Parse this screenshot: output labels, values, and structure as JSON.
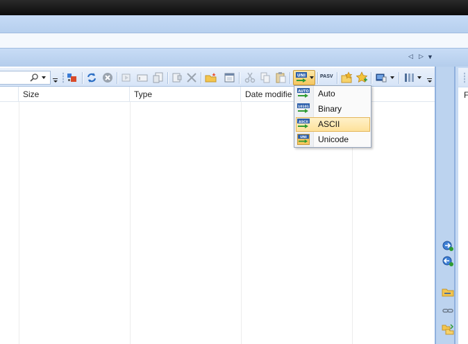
{
  "window": {
    "title": ""
  },
  "columns": [
    {
      "label": ""
    },
    {
      "label": "Size"
    },
    {
      "label": "Type"
    },
    {
      "label": "Date modifie"
    },
    {
      "label": ""
    }
  ],
  "right_pane": {
    "column_label": "F"
  },
  "toolbar": {
    "pasv_label": "PASV",
    "buttons": [
      "search-icon",
      "queue-icon",
      "refresh-icon",
      "stop-icon",
      "connect-icon",
      "rename-icon",
      "properties-icon",
      "view-icon",
      "delete-icon",
      "new-folder-icon",
      "copy-window-icon",
      "cut-icon",
      "copy-icon",
      "paste-icon",
      "transfer-mode-icon",
      "pasv-icon",
      "add-bookmark-icon",
      "favorites-icon",
      "display-icon",
      "columns-icon"
    ]
  },
  "transfer_mode_menu": {
    "items": [
      {
        "label": "Auto",
        "icon_text": "AUTO",
        "selected": false
      },
      {
        "label": "Binary",
        "icon_text": "10101",
        "selected": false
      },
      {
        "label": "ASCII",
        "icon_text": "ASCII",
        "selected": true
      },
      {
        "label": "Unicode",
        "icon_text": "UNI",
        "selected": false
      }
    ]
  },
  "colors": {
    "accent": "#f5c65e",
    "band": "#bcd3ef",
    "menu_highlight": "#fde19a"
  }
}
